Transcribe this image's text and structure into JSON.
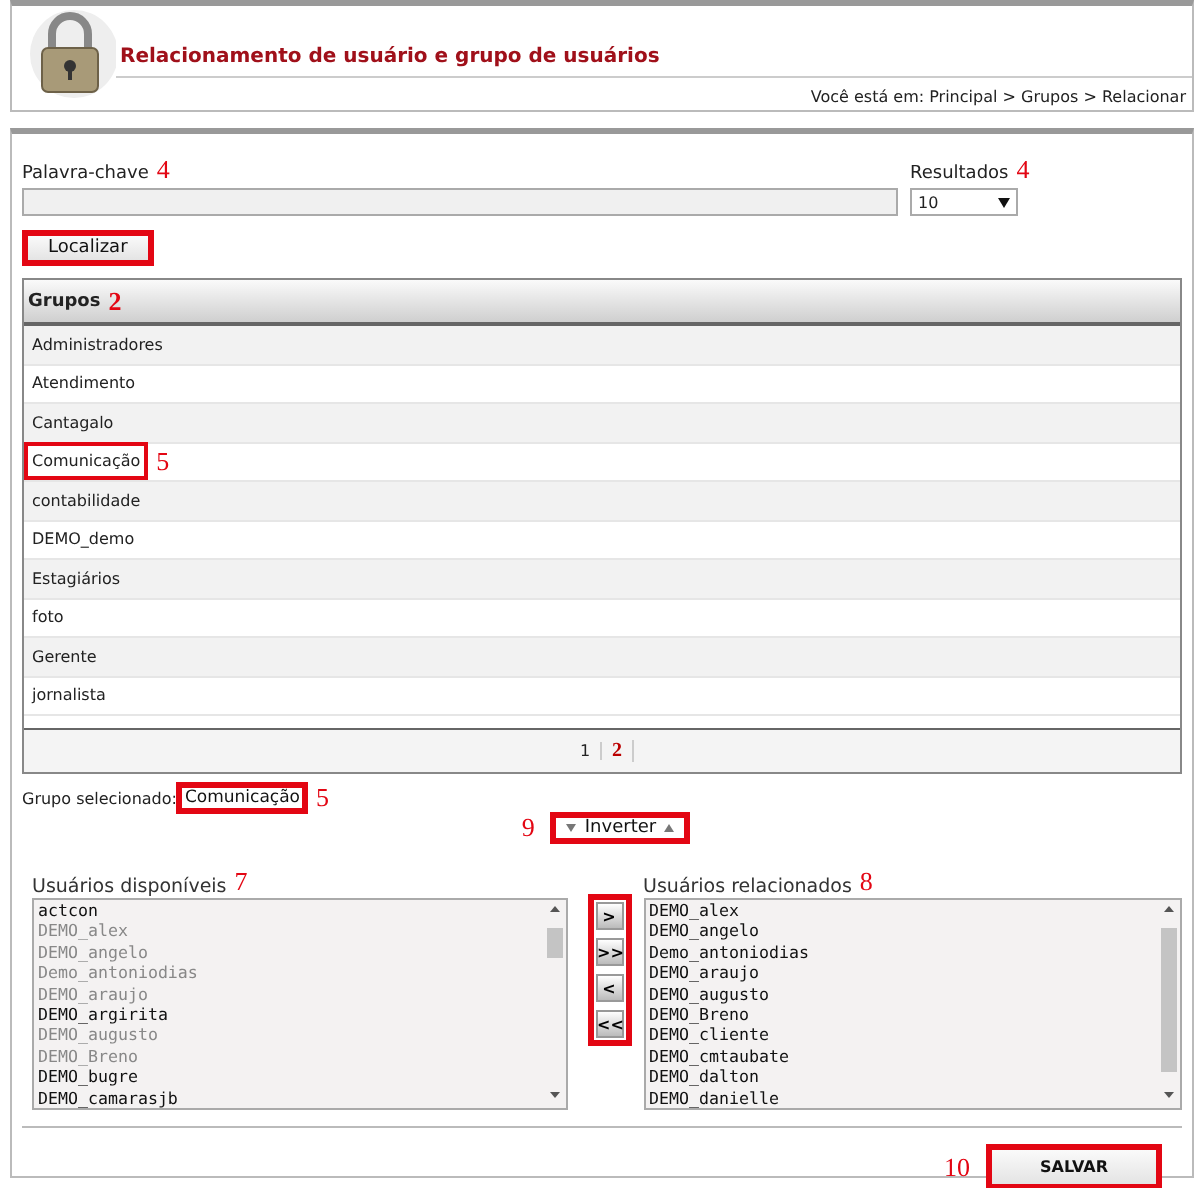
{
  "header": {
    "title": "Relacionamento de usuário e grupo de usuários",
    "breadcrumb": "Você está em: Principal > Grupos > Relacionar"
  },
  "search": {
    "label": "Palavra-chave",
    "callout": "4",
    "results_label": "Resultados",
    "results_callout": "4",
    "results_value": "10",
    "button": {
      "label": "Localizar",
      "highlighted": true
    }
  },
  "groups": {
    "heading": "Grupos",
    "callout": "2",
    "rows": [
      {
        "name": "Administradores",
        "highlighted": false
      },
      {
        "name": "Atendimento",
        "highlighted": false
      },
      {
        "name": "Cantagalo",
        "highlighted": false
      },
      {
        "name": "Comunicação",
        "highlighted": true,
        "callout": "5"
      },
      {
        "name": "contabilidade",
        "highlighted": false
      },
      {
        "name": "DEMO_demo",
        "highlighted": false
      },
      {
        "name": "Estagiários",
        "highlighted": false
      },
      {
        "name": "foto",
        "highlighted": false
      },
      {
        "name": "Gerente",
        "highlighted": false
      },
      {
        "name": "jornalista",
        "highlighted": false
      }
    ],
    "pages": [
      {
        "label": "1",
        "selected": false
      },
      {
        "label": "2",
        "selected": true
      }
    ]
  },
  "selected_group": {
    "label": "Grupo selecionado:",
    "value": "Comunicação",
    "callout": "5",
    "highlighted": true
  },
  "invert": {
    "label": "Inverter",
    "callout": "9",
    "highlighted": true
  },
  "available": {
    "title": "Usuários disponíveis",
    "callout": "7",
    "items": [
      {
        "name": "actcon",
        "disabled": false
      },
      {
        "name": "DEMO_alex",
        "disabled": true
      },
      {
        "name": "DEMO_angelo",
        "disabled": true
      },
      {
        "name": "Demo_antoniodias",
        "disabled": true
      },
      {
        "name": "DEMO_araujo",
        "disabled": true
      },
      {
        "name": "DEMO_argirita",
        "disabled": false
      },
      {
        "name": "DEMO_augusto",
        "disabled": true
      },
      {
        "name": "DEMO_Breno",
        "disabled": true
      },
      {
        "name": "DEMO_bugre",
        "disabled": false
      },
      {
        "name": "DEMO_camarasjb",
        "disabled": false
      }
    ]
  },
  "transfer": {
    "highlighted": true,
    "buttons": [
      ">",
      ">>",
      "<",
      "<<"
    ]
  },
  "related": {
    "title": "Usuários relacionados",
    "callout": "8",
    "items": [
      {
        "name": "DEMO_alex"
      },
      {
        "name": "DEMO_angelo"
      },
      {
        "name": "Demo_antoniodias"
      },
      {
        "name": "DEMO_araujo"
      },
      {
        "name": "DEMO_augusto"
      },
      {
        "name": "DEMO_Breno"
      },
      {
        "name": "DEMO_cliente"
      },
      {
        "name": "DEMO_cmtaubate"
      },
      {
        "name": "DEMO_dalton"
      },
      {
        "name": "DEMO_danielle"
      }
    ]
  },
  "save": {
    "label": "SALVAR",
    "callout": "10",
    "highlighted": true
  }
}
